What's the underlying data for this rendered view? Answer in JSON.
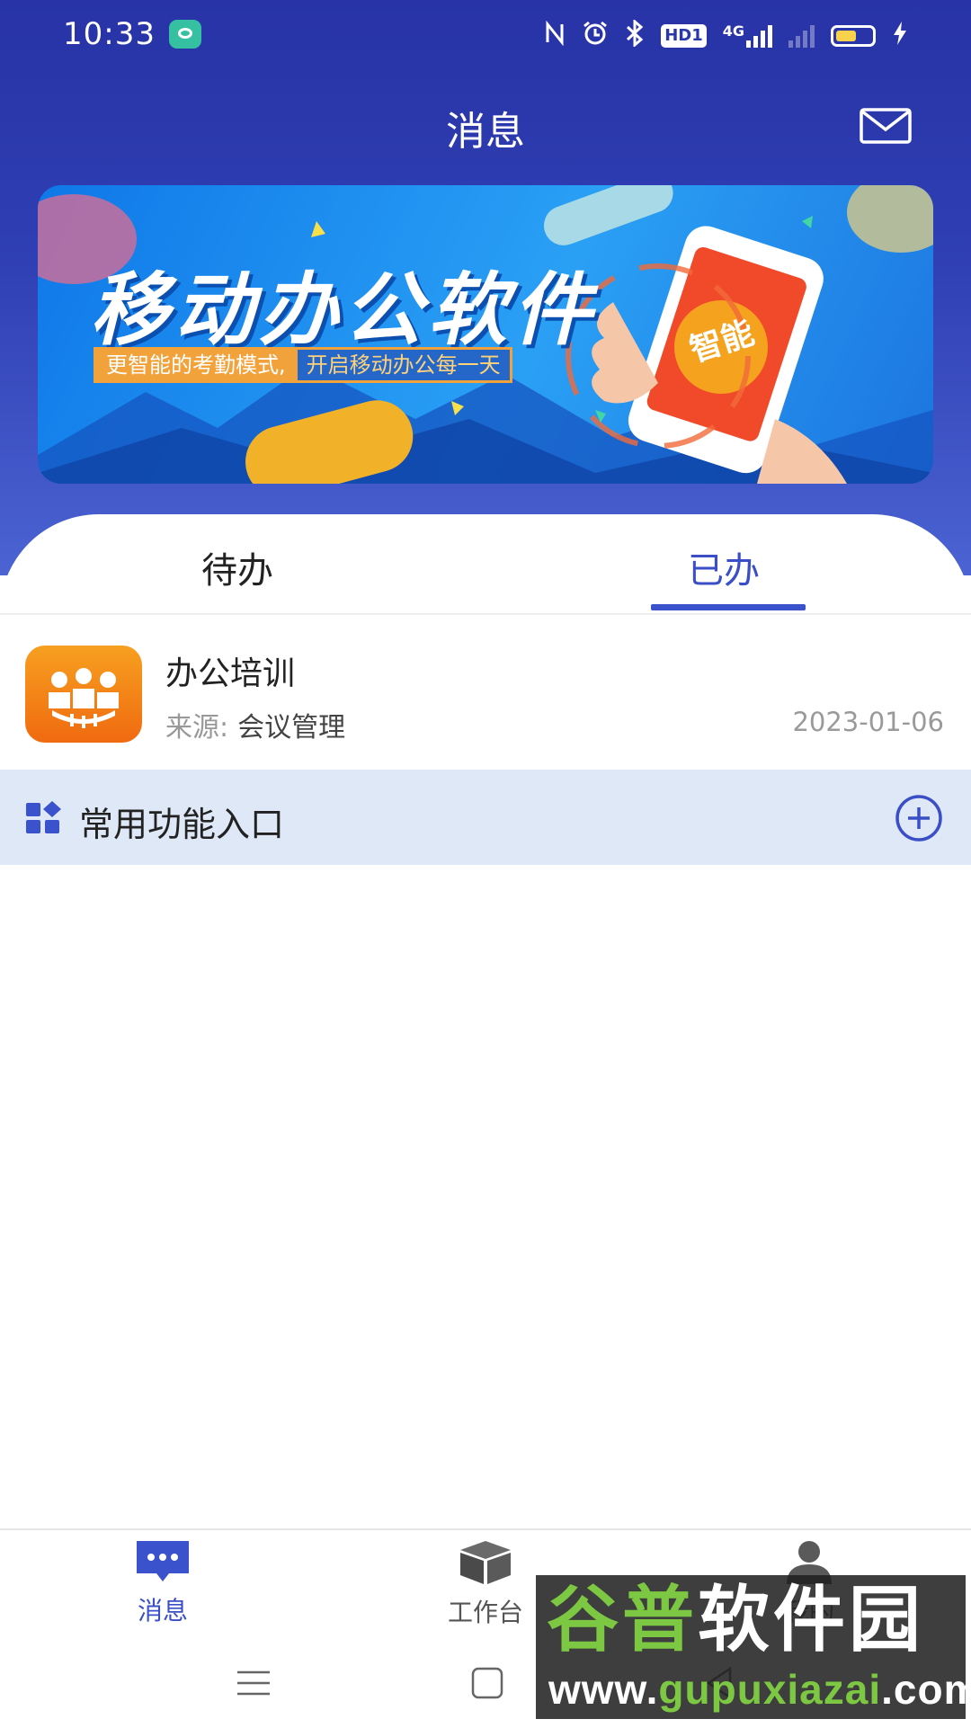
{
  "status_bar": {
    "time": "10:33",
    "network": "4G",
    "hd_badge": "HD1",
    "icons": [
      "chat-app-icon",
      "nfc-icon",
      "alarm-icon",
      "bluetooth-icon",
      "hd-icon",
      "signal-4g-icon",
      "signal-off-icon",
      "battery-icon",
      "charging-icon"
    ]
  },
  "header": {
    "title": "消息",
    "mail_icon": "mail-icon"
  },
  "banner": {
    "title": "移动办公软件",
    "subtitle_part1": "更智能的考勤模式,",
    "subtitle_part2": "开启移动办公每一天",
    "badge": "智能"
  },
  "tabs": [
    {
      "label": "待办",
      "selected": false
    },
    {
      "label": "已办",
      "selected": true
    }
  ],
  "messages": [
    {
      "title": "办公培训",
      "source_label": "来源:",
      "source_value": "会议管理",
      "date": "2023-01-06",
      "icon": "meeting-icon"
    }
  ],
  "quick_access": {
    "label": "常用功能入口",
    "icon": "apps-grid-icon",
    "add_icon": "add-circle-icon"
  },
  "bottom_nav": [
    {
      "label": "消息",
      "icon": "message-icon",
      "active": true
    },
    {
      "label": "工作台",
      "icon": "workbench-box-icon",
      "active": false
    },
    {
      "label": "我的",
      "icon": "person-icon",
      "active": false
    }
  ],
  "system_nav": [
    "menu-icon",
    "home-square-icon",
    "back-icon"
  ],
  "watermark": {
    "line1_part1": "谷普",
    "line1_part2": "软件园",
    "line2_part1": "www.",
    "line2_part2": "gupuxiazai",
    "line2_part3": ".com"
  },
  "colors": {
    "header_top": "#2733a6",
    "header_bottom": "#4b63d3",
    "accent": "#3a52cc",
    "quick_bg": "#dfe8f7",
    "app_icon_orange": "#f28a1c"
  }
}
